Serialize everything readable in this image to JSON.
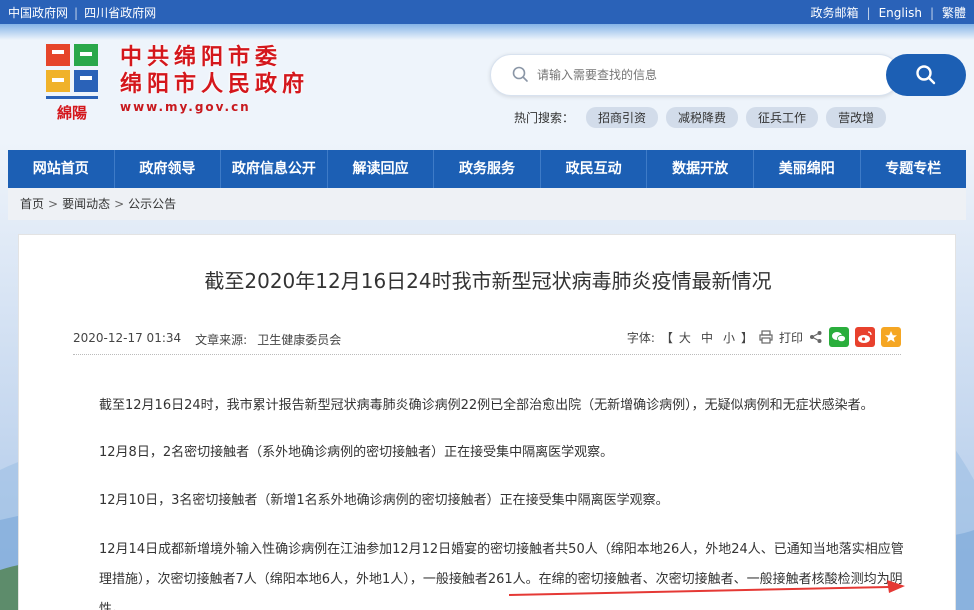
{
  "topbar": {
    "links_left": [
      "中国政府网",
      "四川省政府网"
    ],
    "links_right": [
      "政务邮箱",
      "English",
      "繁體"
    ]
  },
  "header": {
    "title_line1": "中共绵阳市委",
    "title_line2": "绵阳市人民政府",
    "url": "www.my.gov.cn",
    "logo_text": "綿陽"
  },
  "search": {
    "placeholder": "请输入需要查找的信息",
    "hot_label": "热门搜索：",
    "hot_tags": [
      "招商引资",
      "减税降费",
      "征兵工作",
      "营改增"
    ]
  },
  "nav": [
    "网站首页",
    "政府领导",
    "政府信息公开",
    "解读回应",
    "政务服务",
    "政民互动",
    "数据开放",
    "美丽绵阳",
    "专题专栏"
  ],
  "breadcrumb": [
    "首页",
    "要闻动态",
    "公示公告"
  ],
  "article": {
    "title": "截至2020年12月16日24时我市新型冠状病毒肺炎疫情最新情况",
    "date": "2020-12-17 01:34",
    "source_label": "文章来源:",
    "source": "卫生健康委员会",
    "font_label": "字体:",
    "font_open": "【",
    "font_sizes": [
      "大",
      "中",
      "小"
    ],
    "font_close": "】",
    "print": "打印",
    "paragraphs": [
      "截至12月16日24时，我市累计报告新型冠状病毒肺炎确诊病例22例已全部治愈出院（无新增确诊病例），无疑似病例和无症状感染者。",
      "12月8日，2名密切接触者（系外地确诊病例的密切接触者）正在接受集中隔离医学观察。",
      "12月10日，3名密切接触者（新增1名系外地确诊病例的密切接触者）正在接受集中隔离医学观察。",
      "12月14日成都新增境外输入性确诊病例在江油参加12月12日婚宴的密切接触者共50人（绵阳本地26人，外地24人、已通知当地落实相应管理措施），次密切接触者7人（绵阳本地6人，外地1人），一般接触者261人。在绵的密切接触者、次密切接触者、一般接触者核酸检测均为阴性。"
    ]
  },
  "colors": {
    "nav_bg": "#1c5fb4",
    "title_red": "#d4171c",
    "wechat": "#2aae3c",
    "weibo": "#e8412d",
    "favorite": "#f5a623",
    "arrow": "#e53935"
  }
}
